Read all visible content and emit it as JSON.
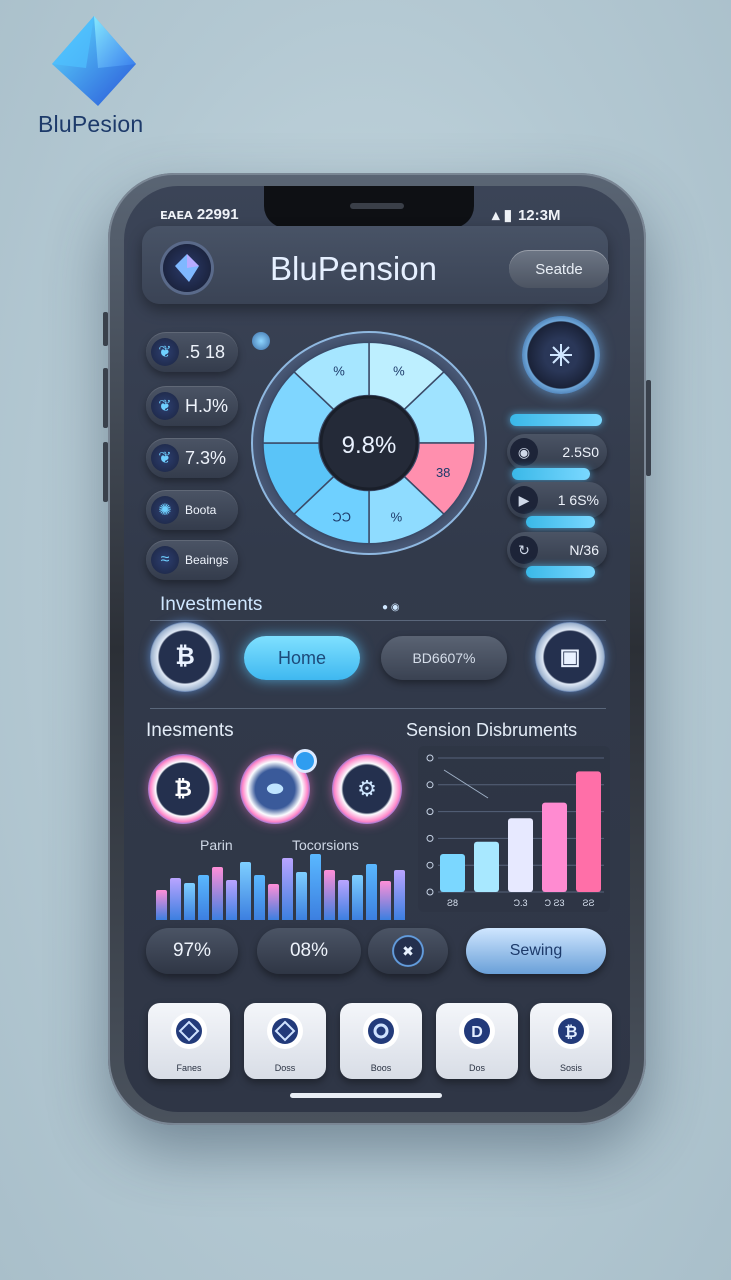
{
  "brand": {
    "name": "BluPesion"
  },
  "status_bar": {
    "left": "ᴇᴀᴇᴀ 22991",
    "right": "12:3M"
  },
  "header": {
    "title": "BluPension",
    "search_label": "Seatde"
  },
  "left_stats": [
    {
      "value": ".5 18",
      "icon": "leaf-icon"
    },
    {
      "value": "H.J%",
      "icon": "leaf-icon"
    },
    {
      "value": "7.3%",
      "icon": "leaf-icon"
    },
    {
      "value": "Boota",
      "icon": "swirl-icon"
    },
    {
      "value": "Beaings",
      "icon": "wave-icon"
    }
  ],
  "gauge": {
    "center_value": "9.8%",
    "segment_labels": [
      "%",
      "%",
      "38",
      "ƆƆ",
      "%"
    ]
  },
  "right_stats": [
    {
      "value": "2.5S0",
      "bar_fill": 0.85
    },
    {
      "value": "1 6S%",
      "bar_fill": 0.75
    },
    {
      "value": "N/36",
      "bar_fill": 0.75
    }
  ],
  "investments_header": "Investments",
  "nav": {
    "home_label": "Home",
    "secondary_label": "BD6607%"
  },
  "section2": {
    "left_title": "Inesments",
    "right_title": "Sension Disbruments"
  },
  "mini_labels": {
    "left": "Parin",
    "right": "Tocorsions"
  },
  "spark_bars": [
    0.42,
    0.58,
    0.52,
    0.62,
    0.74,
    0.55,
    0.8,
    0.63,
    0.5,
    0.86,
    0.66,
    0.92,
    0.7,
    0.56,
    0.62,
    0.78,
    0.54,
    0.7
  ],
  "chart_data": {
    "type": "bar",
    "categories": [
      "Ƨ8",
      "",
      "Ɔ.3",
      "Ɔ Ƨ3",
      "ƧƧ"
    ],
    "values": [
      34,
      45,
      66,
      80,
      108
    ],
    "series_colors": [
      "#7bd7ff",
      "#a8e8ff",
      "#e7e9ff",
      "#ff8bd1",
      "#ff6fa8"
    ]
  },
  "bottom_pills": [
    "97%",
    "08%",
    "",
    "Sewing"
  ],
  "tabs": [
    {
      "label": "Fanes",
      "icon": "diamond-icon"
    },
    {
      "label": "Doss",
      "icon": "diamond-icon"
    },
    {
      "label": "Boos",
      "icon": "gear-icon"
    },
    {
      "label": "Dos",
      "icon": "dollar-icon"
    },
    {
      "label": "Sosis",
      "icon": "dollar-icon"
    }
  ],
  "colors": {
    "accent": "#55c6ff",
    "pink": "#ff6fa8",
    "screen": "#343c4d"
  }
}
